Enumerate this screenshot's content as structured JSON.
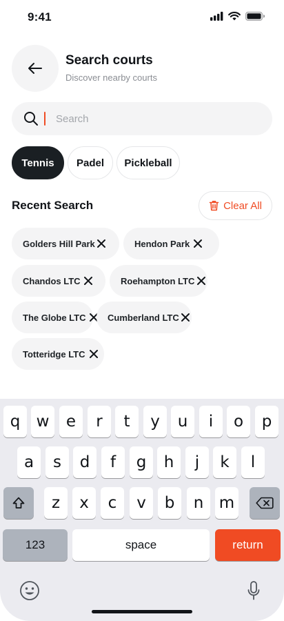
{
  "status_bar": {
    "time": "9:41"
  },
  "header": {
    "title": "Search courts",
    "subtitle": "Discover nearby courts",
    "back_icon": "arrow-left-icon"
  },
  "search": {
    "placeholder": "Search",
    "value": ""
  },
  "sport_filters": [
    {
      "label": "Tennis",
      "active": true
    },
    {
      "label": "Padel",
      "active": false
    },
    {
      "label": "Pickleball",
      "active": false
    }
  ],
  "recent": {
    "title": "Recent Search",
    "clear_label": "Clear All",
    "items": [
      "Golders Hill Park",
      "Hendon Park",
      "Chandos LTC",
      "Roehampton LTC",
      "The Globe LTC",
      "Cumberland LTC",
      "Totteridge LTC"
    ]
  },
  "keyboard": {
    "row1": [
      "q",
      "w",
      "e",
      "r",
      "t",
      "y",
      "u",
      "i",
      "o",
      "p"
    ],
    "row2": [
      "a",
      "s",
      "d",
      "f",
      "g",
      "h",
      "j",
      "k",
      "l"
    ],
    "row3": [
      "z",
      "x",
      "c",
      "v",
      "b",
      "n",
      "m"
    ],
    "numbers_label": "123",
    "space_label": "space",
    "return_label": "return"
  },
  "colors": {
    "accent": "#f04b23",
    "chip_active": "#1a1f23",
    "surface": "#f4f4f5"
  }
}
